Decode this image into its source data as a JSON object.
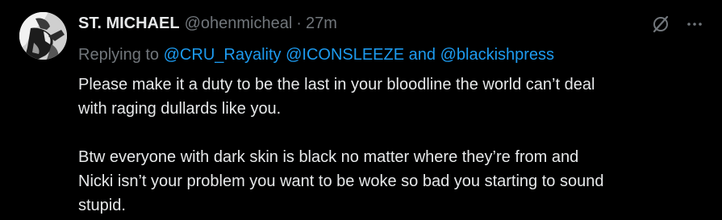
{
  "author": {
    "display_name": "ST. MICHAEL",
    "handle": "@ohenmicheal",
    "separator": "·",
    "time": "27m"
  },
  "reply": {
    "prefix": "Replying to",
    "mention_1": "@CRU_Rayality",
    "mention_2": "@ICONSLEEZE",
    "conjunction": "and",
    "mention_3": "@blackishpress"
  },
  "body": {
    "paragraph_1_line_1": "Please make it a duty to be the last in your bloodline the world can’t deal",
    "paragraph_1_line_2": "with raging dullards like you.",
    "paragraph_2_line_1": "Btw everyone with dark skin is black no matter where they’re from and",
    "paragraph_2_line_2": "Nicki isn’t your problem you want to be woke so bad you starting to sound",
    "paragraph_2_line_3": "stupid."
  },
  "icons": {
    "grok": "grok-icon",
    "more": "more-icon"
  },
  "colors": {
    "background": "#000000",
    "primary_text": "#e7e9ea",
    "secondary_text": "#71767b",
    "link": "#1d9bf0"
  }
}
